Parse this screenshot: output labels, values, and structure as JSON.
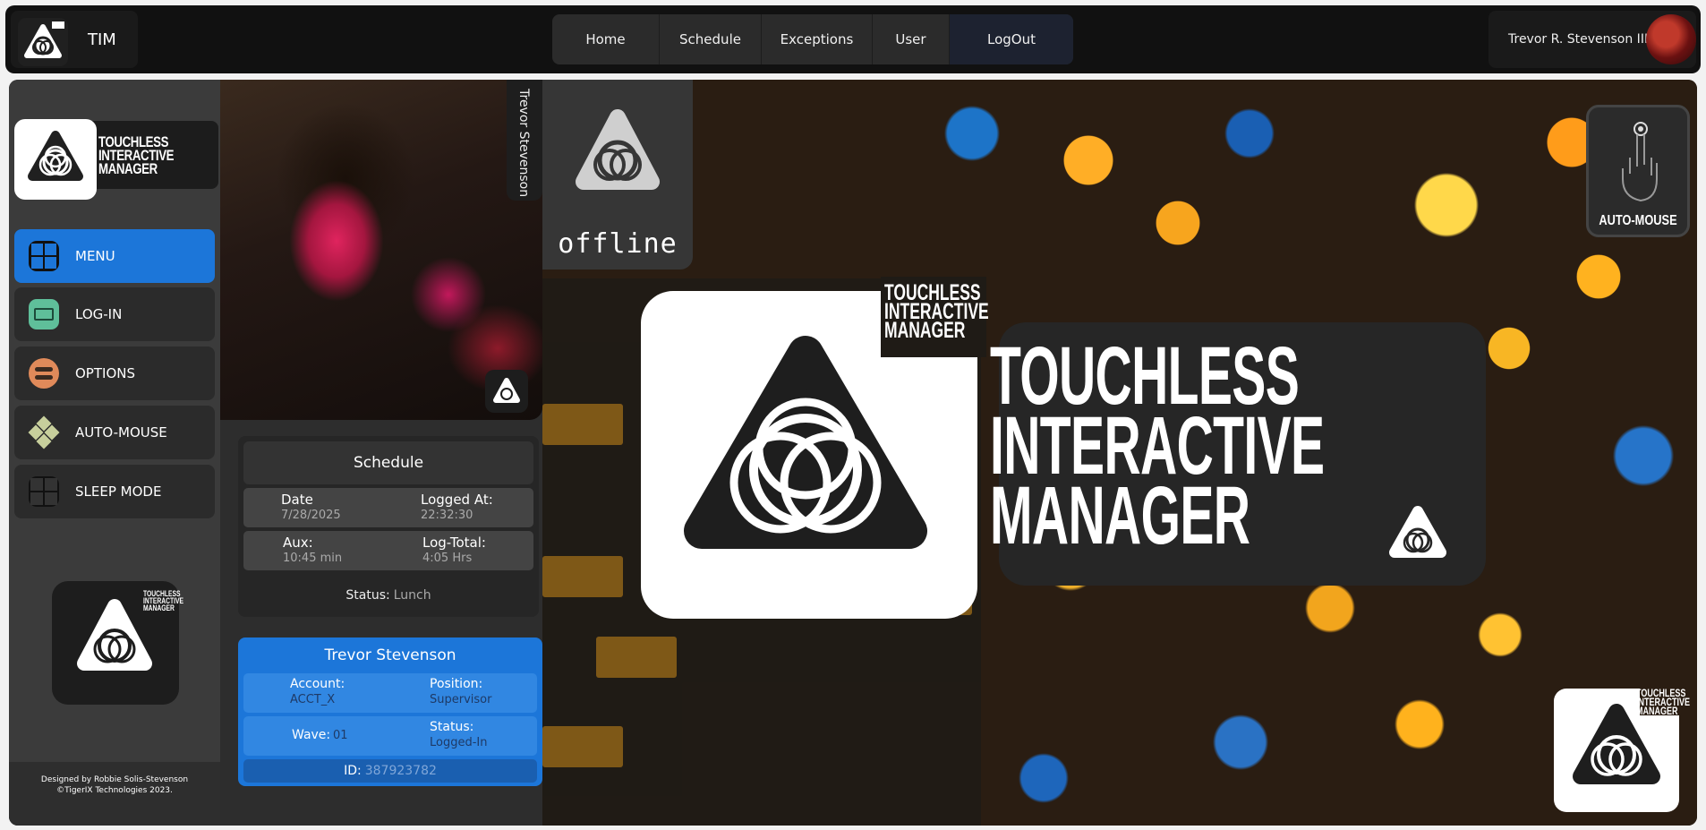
{
  "app": {
    "title": "TIM"
  },
  "nav": {
    "items": [
      {
        "label": "Home"
      },
      {
        "label": "Schedule"
      },
      {
        "label": "Exceptions"
      },
      {
        "label": "User"
      },
      {
        "label": "LogOut"
      }
    ]
  },
  "user": {
    "display_name": "Trevor R. Stevenson III"
  },
  "sidebar": {
    "brand_wordmark": "TOUCHLESS INTERACTIVE MANAGER",
    "items": [
      {
        "label": "MENU",
        "icon": "grid-icon",
        "color": "#1c76d9"
      },
      {
        "label": "LOG-IN",
        "icon": "login-card-icon",
        "color": "#5fbf9a"
      },
      {
        "label": "OPTIONS",
        "icon": "options-icon",
        "color": "#e08a5a"
      },
      {
        "label": "AUTO-MOUSE",
        "icon": "diamonds-icon",
        "color": "#c7cf9c"
      },
      {
        "label": "SLEEP MODE",
        "icon": "sleep-grid-icon",
        "color": "#2a2a2a"
      }
    ],
    "sleep_logo_wordmark": "TOUCHLESS INTERACTIVE MANAGER",
    "credits": [
      "Designed by Robbie Solis-Stevenson",
      "©TigerIX Technologies 2023."
    ]
  },
  "photo": {
    "tag": "Trevor Stevenson"
  },
  "schedule": {
    "title": "Schedule",
    "date_label": "Date",
    "date_value": "7/28/2025",
    "logged_at_label": "Logged At:",
    "logged_at_value": "22:32:30",
    "aux_label": "Aux:",
    "aux_value": "10:45 min",
    "log_total_label": "Log-Total:",
    "log_total_value": "4:05 Hrs",
    "status_label": "Status:",
    "status_value": "Lunch"
  },
  "profile": {
    "name": "Trevor Stevenson",
    "account_label": "Account:",
    "account_value": "ACCT_X",
    "position_label": "Position:",
    "position_value": "Supervisor",
    "wave_label": "Wave:",
    "wave_value": "01",
    "status_label": "Status:",
    "status_value": "Logged-In",
    "id_label": "ID:",
    "id_value": "387923782"
  },
  "hero": {
    "offline_text": "offline",
    "automouse_label": "AUTO-MOUSE",
    "wordmark_line1": "TOUCHLESS",
    "wordmark_line2": "INTERACTIVE",
    "wordmark_line3": "MANAGER",
    "small_wordmark": "TOUCHLESS INTERACTIVE MANAGER",
    "corner_wordmark": "TOUCHLESS INTERACTIVE MANAGER"
  },
  "colors": {
    "accent": "#1c76d9",
    "dark": "#1e1e1e",
    "panel": "#2b2b2b"
  }
}
